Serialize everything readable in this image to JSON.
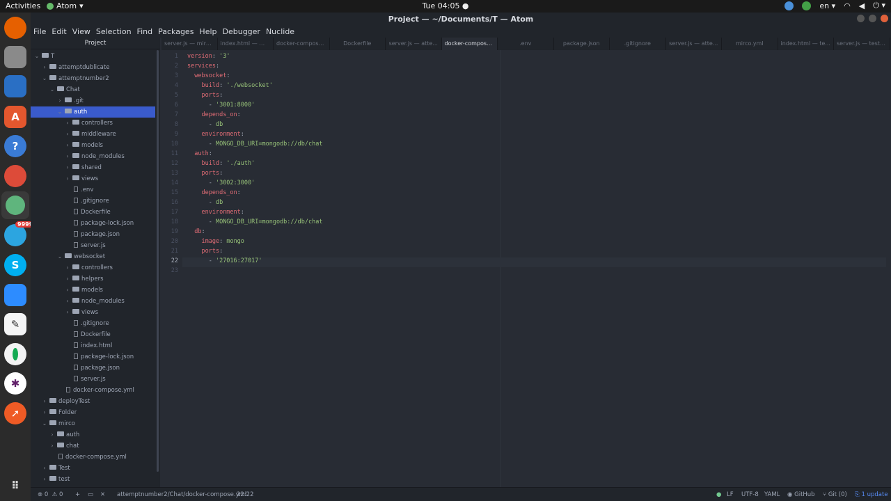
{
  "topbar": {
    "activities": "Activities",
    "app_name": "Atom",
    "clock": "Tue 04:05 ●",
    "lang": "en"
  },
  "window": {
    "title": "Project — ~/Documents/T — Atom"
  },
  "menu": [
    "File",
    "Edit",
    "View",
    "Selection",
    "Find",
    "Packages",
    "Help",
    "Debugger",
    "Nuclide"
  ],
  "dock": {
    "telegram_badge": "9999"
  },
  "tree": {
    "header": "Project",
    "rows": [
      {
        "label": "T",
        "kind": "folder",
        "open": true,
        "depth": 0
      },
      {
        "label": "attemptdublicate",
        "kind": "folder",
        "open": false,
        "depth": 1
      },
      {
        "label": "attemptnumber2",
        "kind": "folder",
        "open": true,
        "depth": 1
      },
      {
        "label": "Chat",
        "kind": "folder",
        "open": true,
        "depth": 2
      },
      {
        "label": ".git",
        "kind": "folder",
        "open": false,
        "depth": 3
      },
      {
        "label": "auth",
        "kind": "folder",
        "open": true,
        "depth": 3,
        "selected": true
      },
      {
        "label": "controllers",
        "kind": "folder",
        "open": false,
        "depth": 4
      },
      {
        "label": "middleware",
        "kind": "folder",
        "open": false,
        "depth": 4
      },
      {
        "label": "models",
        "kind": "folder",
        "open": false,
        "depth": 4
      },
      {
        "label": "node_modules",
        "kind": "folder",
        "open": false,
        "depth": 4
      },
      {
        "label": "shared",
        "kind": "folder",
        "open": false,
        "depth": 4
      },
      {
        "label": "views",
        "kind": "folder",
        "open": false,
        "depth": 4
      },
      {
        "label": ".env",
        "kind": "file",
        "depth": 4
      },
      {
        "label": ".gitignore",
        "kind": "file",
        "depth": 4
      },
      {
        "label": "Dockerfile",
        "kind": "file",
        "depth": 4
      },
      {
        "label": "package-lock.json",
        "kind": "file",
        "depth": 4
      },
      {
        "label": "package.json",
        "kind": "file",
        "depth": 4
      },
      {
        "label": "server.js",
        "kind": "file",
        "depth": 4
      },
      {
        "label": "websocket",
        "kind": "folder",
        "open": true,
        "depth": 3
      },
      {
        "label": "controllers",
        "kind": "folder",
        "open": false,
        "depth": 4
      },
      {
        "label": "helpers",
        "kind": "folder",
        "open": false,
        "depth": 4
      },
      {
        "label": "models",
        "kind": "folder",
        "open": false,
        "depth": 4
      },
      {
        "label": "node_modules",
        "kind": "folder",
        "open": false,
        "depth": 4
      },
      {
        "label": "views",
        "kind": "folder",
        "open": false,
        "depth": 4
      },
      {
        "label": ".gitignore",
        "kind": "file",
        "depth": 4
      },
      {
        "label": "Dockerfile",
        "kind": "file",
        "depth": 4
      },
      {
        "label": "index.html",
        "kind": "file",
        "depth": 4
      },
      {
        "label": "package-lock.json",
        "kind": "file",
        "depth": 4
      },
      {
        "label": "package.json",
        "kind": "file",
        "depth": 4
      },
      {
        "label": "server.js",
        "kind": "file",
        "depth": 4
      },
      {
        "label": "docker-compose.yml",
        "kind": "file",
        "depth": 3
      },
      {
        "label": "deployTest",
        "kind": "folder",
        "open": false,
        "depth": 1
      },
      {
        "label": "Folder",
        "kind": "folder",
        "open": false,
        "depth": 1
      },
      {
        "label": "mirco",
        "kind": "folder",
        "open": true,
        "depth": 1
      },
      {
        "label": "auth",
        "kind": "folder",
        "open": false,
        "depth": 2
      },
      {
        "label": "chat",
        "kind": "folder",
        "open": false,
        "depth": 2
      },
      {
        "label": "docker-compose.yml",
        "kind": "file",
        "depth": 2
      },
      {
        "label": "Test",
        "kind": "folder",
        "open": false,
        "depth": 1
      },
      {
        "label": "test",
        "kind": "folder",
        "open": false,
        "depth": 1
      }
    ]
  },
  "tabs": [
    {
      "label": "server.js — mirc...",
      "active": false
    },
    {
      "label": "index.html — mi...",
      "active": false
    },
    {
      "label": "docker-compose...",
      "active": false
    },
    {
      "label": "Dockerfile",
      "active": false
    },
    {
      "label": "server.js — atte...",
      "active": false
    },
    {
      "label": "docker-compose....",
      "active": true
    },
    {
      "label": ".env",
      "active": false
    },
    {
      "label": "package.json",
      "active": false
    },
    {
      "label": ".gitignore",
      "active": false
    },
    {
      "label": "server.js — atte...",
      "active": false
    },
    {
      "label": "mirco.yml",
      "active": false
    },
    {
      "label": "index.html — te...",
      "active": false
    },
    {
      "label": "server.js — test/...",
      "active": false
    }
  ],
  "editor": {
    "cursor_line": 22,
    "lines": [
      [
        {
          "t": "version",
          "c": "k"
        },
        {
          "t": ": "
        },
        {
          "t": "'3'",
          "c": "s"
        }
      ],
      [
        {
          "t": "services",
          "c": "k"
        },
        {
          "t": ":"
        }
      ],
      [
        {
          "t": "  "
        },
        {
          "t": "websocket",
          "c": "k"
        },
        {
          "t": ":"
        }
      ],
      [
        {
          "t": "    "
        },
        {
          "t": "build",
          "c": "k"
        },
        {
          "t": ": "
        },
        {
          "t": "'./websocket'",
          "c": "s"
        }
      ],
      [
        {
          "t": "    "
        },
        {
          "t": "ports",
          "c": "k"
        },
        {
          "t": ":"
        }
      ],
      [
        {
          "t": "      - "
        },
        {
          "t": "'3001:8000'",
          "c": "s"
        }
      ],
      [
        {
          "t": "    "
        },
        {
          "t": "depends_on",
          "c": "k"
        },
        {
          "t": ":"
        }
      ],
      [
        {
          "t": "      - "
        },
        {
          "t": "db",
          "c": "s"
        }
      ],
      [
        {
          "t": "    "
        },
        {
          "t": "environment",
          "c": "k"
        },
        {
          "t": ":"
        }
      ],
      [
        {
          "t": "      - "
        },
        {
          "t": "MONGO_DB_URI=mongodb://db/chat",
          "c": "s"
        }
      ],
      [
        {
          "t": "  "
        },
        {
          "t": "auth",
          "c": "k"
        },
        {
          "t": ":"
        }
      ],
      [
        {
          "t": "    "
        },
        {
          "t": "build",
          "c": "k"
        },
        {
          "t": ": "
        },
        {
          "t": "'./auth'",
          "c": "s"
        }
      ],
      [
        {
          "t": "    "
        },
        {
          "t": "ports",
          "c": "k"
        },
        {
          "t": ":"
        }
      ],
      [
        {
          "t": "      - "
        },
        {
          "t": "'3002:3000'",
          "c": "s"
        }
      ],
      [
        {
          "t": "    "
        },
        {
          "t": "depends_on",
          "c": "k"
        },
        {
          "t": ":"
        }
      ],
      [
        {
          "t": "      - "
        },
        {
          "t": "db",
          "c": "s"
        }
      ],
      [
        {
          "t": "    "
        },
        {
          "t": "environment",
          "c": "k"
        },
        {
          "t": ":"
        }
      ],
      [
        {
          "t": "      - "
        },
        {
          "t": "MONGO_DB_URI=mongodb://db/chat",
          "c": "s"
        }
      ],
      [
        {
          "t": "  "
        },
        {
          "t": "db",
          "c": "k"
        },
        {
          "t": ":"
        }
      ],
      [
        {
          "t": "    "
        },
        {
          "t": "image",
          "c": "k"
        },
        {
          "t": ": "
        },
        {
          "t": "mongo",
          "c": "s"
        }
      ],
      [
        {
          "t": "    "
        },
        {
          "t": "ports",
          "c": "k"
        },
        {
          "t": ":"
        }
      ],
      [
        {
          "t": "      - "
        },
        {
          "t": "'27016:27017'",
          "c": "s"
        }
      ],
      []
    ]
  },
  "statusbar": {
    "errors": "0",
    "warnings": "0",
    "path": "attemptnumber2/Chat/docker-compose.yml",
    "cursor": "22:22",
    "line_ending": "LF",
    "encoding": "UTF-8",
    "grammar": "YAML",
    "github": "GitHub",
    "git": "Git (0)",
    "update": "1 update"
  }
}
